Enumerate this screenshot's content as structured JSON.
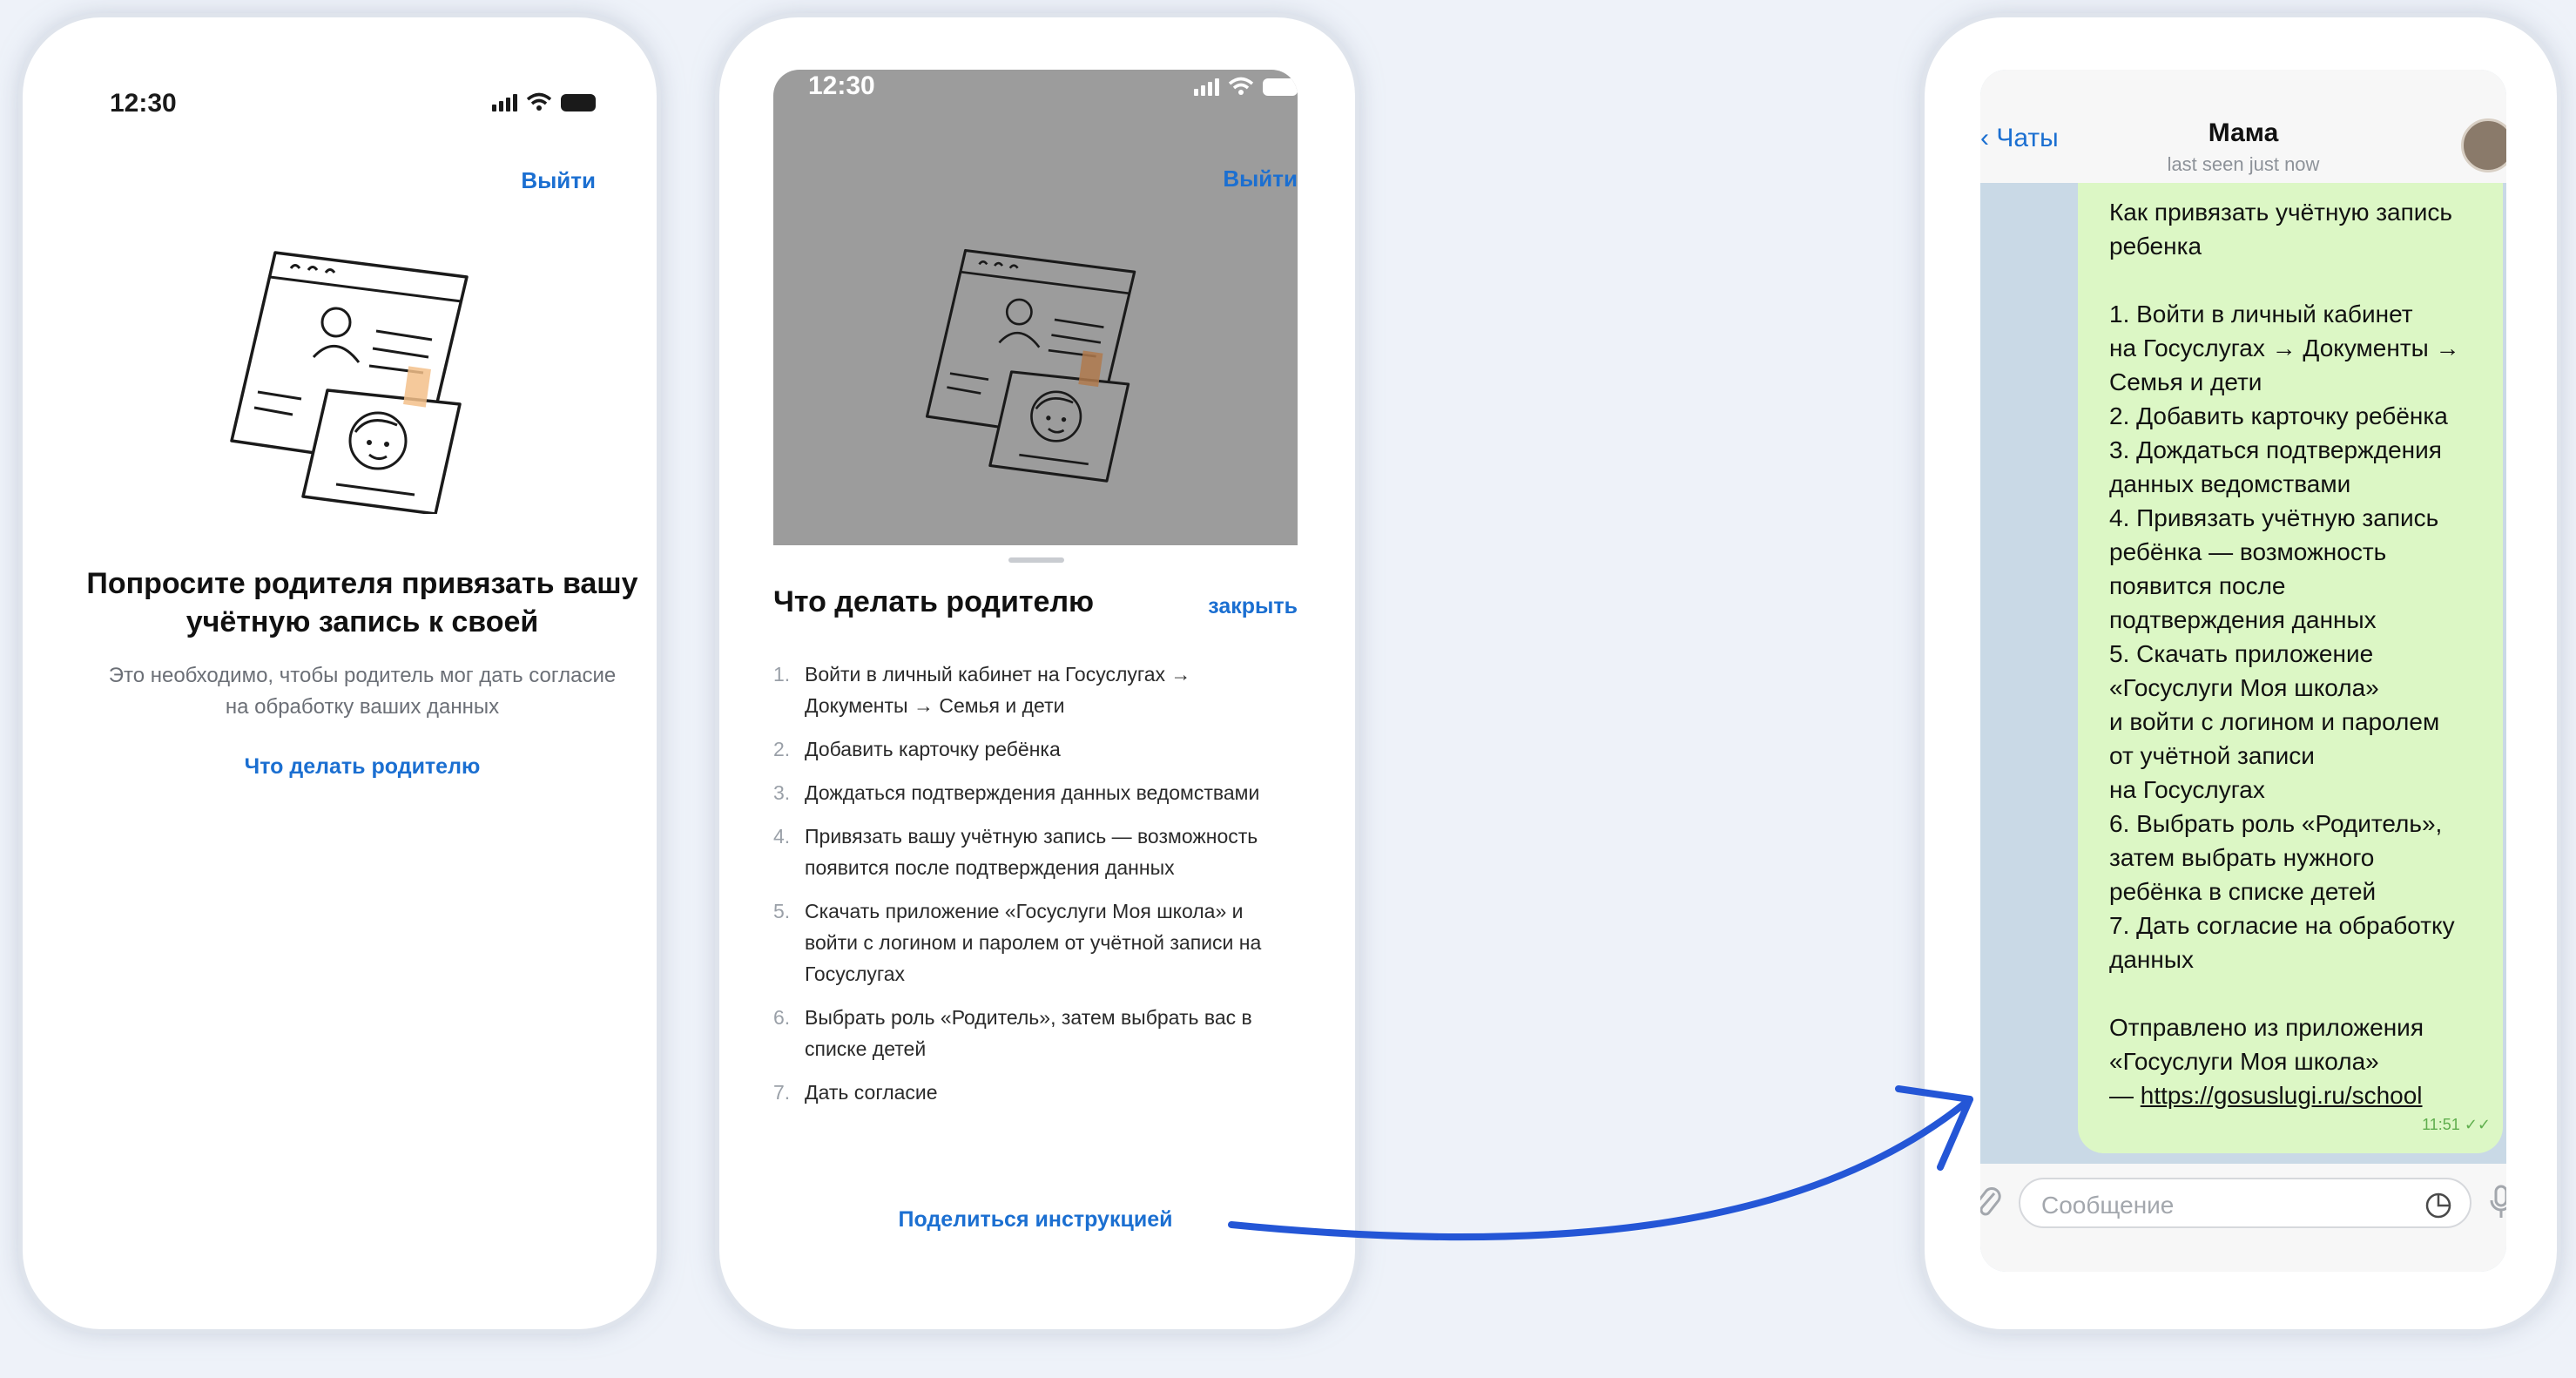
{
  "screen1": {
    "status_time": "12:30",
    "logout_label": "Выйти",
    "title": "Попросите родителя привязать вашу учётную запись к своей",
    "subtitle": "Это необходимо, чтобы родитель мог дать согласие на обработку ваших данных",
    "parent_link": "Что делать родителю"
  },
  "screen2": {
    "status_time": "12:30",
    "logout_label": "Выйти",
    "sheet_title": "Что делать родителю",
    "close_label": "закрыть",
    "steps": [
      {
        "num": "1.",
        "text": "Войти в личный кабинет на Госуслугах → Документы → Семья и дети"
      },
      {
        "num": "2.",
        "text": "Добавить карточку ребёнка"
      },
      {
        "num": "3.",
        "text": "Дождаться подтверждения данных ведомствами"
      },
      {
        "num": "4.",
        "text": "Привязать вашу учётную запись — возможность появится после подтверждения данных"
      },
      {
        "num": "5.",
        "text": "Скачать приложение «Госуслуги Моя школа» и войти с логином и паролем от учётной записи на Госуслугах"
      },
      {
        "num": "6.",
        "text": "Выбрать роль «Родитель», затем выбрать вас в списке детей"
      },
      {
        "num": "7.",
        "text": "Дать согласие"
      }
    ],
    "share_label": "Поделиться инструкцией"
  },
  "screen3": {
    "back_label": "Чаты",
    "contact_name": "Мама",
    "last_seen": "last seen just now",
    "message_text": "Как привязать учётную запись ребенка\n\n1. Войти в личный кабинет\nна Госуслугах → Документы →\nСемья и дети\n2. Добавить карточку ребёнка\n3. Дождаться подтверждения\nданных ведомствами\n4. Привязать учётную запись\nребёнка — возможность\nпоявится после\nподтверждения данных\n5. Скачать приложение\n«Госуслуги Моя школа»\nи войти с логином и паролем\nот учётной записи\nна Госуслугах\n6. Выбрать роль «Родитель»,\nзатем выбрать нужного\nребёнка в списке детей\n7. Дать согласие на обработку\nданных\n\nОтправлено из приложения\n«Госуслуги Моя школа»\n— ",
    "message_link": "https://gosuslugi.ru/school",
    "message_time": "11:51",
    "input_placeholder": "Сообщение"
  },
  "colors": {
    "accent": "#1b6fd1",
    "arrow": "#2456d6",
    "bubble": "#dcf7c5",
    "overlay": "#9c9c9c",
    "background": "#eef2f9"
  },
  "icons": [
    "signal-icon",
    "wifi-icon",
    "battery-icon",
    "document-illustration",
    "attach-icon",
    "sticker-icon",
    "microphone-icon",
    "read-checkmark-icon"
  ]
}
